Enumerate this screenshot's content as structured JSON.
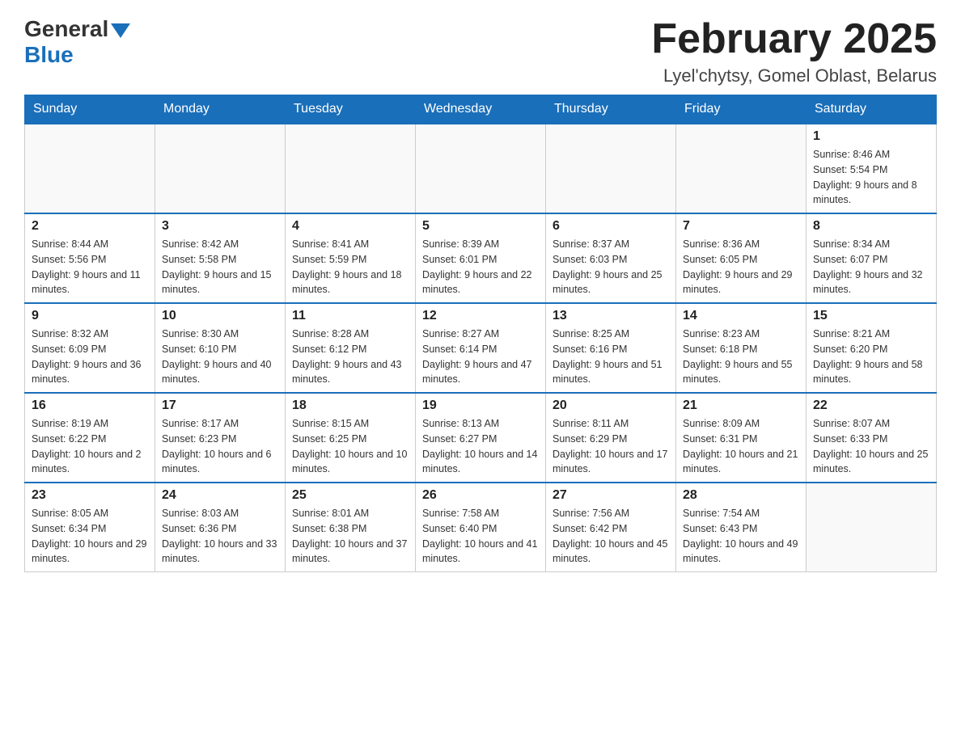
{
  "header": {
    "logo_general": "General",
    "logo_blue": "Blue",
    "month_title": "February 2025",
    "location": "Lyel'chytsy, Gomel Oblast, Belarus"
  },
  "weekdays": [
    "Sunday",
    "Monday",
    "Tuesday",
    "Wednesday",
    "Thursday",
    "Friday",
    "Saturday"
  ],
  "weeks": [
    [
      {
        "day": "",
        "sunrise": "",
        "sunset": "",
        "daylight": ""
      },
      {
        "day": "",
        "sunrise": "",
        "sunset": "",
        "daylight": ""
      },
      {
        "day": "",
        "sunrise": "",
        "sunset": "",
        "daylight": ""
      },
      {
        "day": "",
        "sunrise": "",
        "sunset": "",
        "daylight": ""
      },
      {
        "day": "",
        "sunrise": "",
        "sunset": "",
        "daylight": ""
      },
      {
        "day": "",
        "sunrise": "",
        "sunset": "",
        "daylight": ""
      },
      {
        "day": "1",
        "sunrise": "Sunrise: 8:46 AM",
        "sunset": "Sunset: 5:54 PM",
        "daylight": "Daylight: 9 hours and 8 minutes."
      }
    ],
    [
      {
        "day": "2",
        "sunrise": "Sunrise: 8:44 AM",
        "sunset": "Sunset: 5:56 PM",
        "daylight": "Daylight: 9 hours and 11 minutes."
      },
      {
        "day": "3",
        "sunrise": "Sunrise: 8:42 AM",
        "sunset": "Sunset: 5:58 PM",
        "daylight": "Daylight: 9 hours and 15 minutes."
      },
      {
        "day": "4",
        "sunrise": "Sunrise: 8:41 AM",
        "sunset": "Sunset: 5:59 PM",
        "daylight": "Daylight: 9 hours and 18 minutes."
      },
      {
        "day": "5",
        "sunrise": "Sunrise: 8:39 AM",
        "sunset": "Sunset: 6:01 PM",
        "daylight": "Daylight: 9 hours and 22 minutes."
      },
      {
        "day": "6",
        "sunrise": "Sunrise: 8:37 AM",
        "sunset": "Sunset: 6:03 PM",
        "daylight": "Daylight: 9 hours and 25 minutes."
      },
      {
        "day": "7",
        "sunrise": "Sunrise: 8:36 AM",
        "sunset": "Sunset: 6:05 PM",
        "daylight": "Daylight: 9 hours and 29 minutes."
      },
      {
        "day": "8",
        "sunrise": "Sunrise: 8:34 AM",
        "sunset": "Sunset: 6:07 PM",
        "daylight": "Daylight: 9 hours and 32 minutes."
      }
    ],
    [
      {
        "day": "9",
        "sunrise": "Sunrise: 8:32 AM",
        "sunset": "Sunset: 6:09 PM",
        "daylight": "Daylight: 9 hours and 36 minutes."
      },
      {
        "day": "10",
        "sunrise": "Sunrise: 8:30 AM",
        "sunset": "Sunset: 6:10 PM",
        "daylight": "Daylight: 9 hours and 40 minutes."
      },
      {
        "day": "11",
        "sunrise": "Sunrise: 8:28 AM",
        "sunset": "Sunset: 6:12 PM",
        "daylight": "Daylight: 9 hours and 43 minutes."
      },
      {
        "day": "12",
        "sunrise": "Sunrise: 8:27 AM",
        "sunset": "Sunset: 6:14 PM",
        "daylight": "Daylight: 9 hours and 47 minutes."
      },
      {
        "day": "13",
        "sunrise": "Sunrise: 8:25 AM",
        "sunset": "Sunset: 6:16 PM",
        "daylight": "Daylight: 9 hours and 51 minutes."
      },
      {
        "day": "14",
        "sunrise": "Sunrise: 8:23 AM",
        "sunset": "Sunset: 6:18 PM",
        "daylight": "Daylight: 9 hours and 55 minutes."
      },
      {
        "day": "15",
        "sunrise": "Sunrise: 8:21 AM",
        "sunset": "Sunset: 6:20 PM",
        "daylight": "Daylight: 9 hours and 58 minutes."
      }
    ],
    [
      {
        "day": "16",
        "sunrise": "Sunrise: 8:19 AM",
        "sunset": "Sunset: 6:22 PM",
        "daylight": "Daylight: 10 hours and 2 minutes."
      },
      {
        "day": "17",
        "sunrise": "Sunrise: 8:17 AM",
        "sunset": "Sunset: 6:23 PM",
        "daylight": "Daylight: 10 hours and 6 minutes."
      },
      {
        "day": "18",
        "sunrise": "Sunrise: 8:15 AM",
        "sunset": "Sunset: 6:25 PM",
        "daylight": "Daylight: 10 hours and 10 minutes."
      },
      {
        "day": "19",
        "sunrise": "Sunrise: 8:13 AM",
        "sunset": "Sunset: 6:27 PM",
        "daylight": "Daylight: 10 hours and 14 minutes."
      },
      {
        "day": "20",
        "sunrise": "Sunrise: 8:11 AM",
        "sunset": "Sunset: 6:29 PM",
        "daylight": "Daylight: 10 hours and 17 minutes."
      },
      {
        "day": "21",
        "sunrise": "Sunrise: 8:09 AM",
        "sunset": "Sunset: 6:31 PM",
        "daylight": "Daylight: 10 hours and 21 minutes."
      },
      {
        "day": "22",
        "sunrise": "Sunrise: 8:07 AM",
        "sunset": "Sunset: 6:33 PM",
        "daylight": "Daylight: 10 hours and 25 minutes."
      }
    ],
    [
      {
        "day": "23",
        "sunrise": "Sunrise: 8:05 AM",
        "sunset": "Sunset: 6:34 PM",
        "daylight": "Daylight: 10 hours and 29 minutes."
      },
      {
        "day": "24",
        "sunrise": "Sunrise: 8:03 AM",
        "sunset": "Sunset: 6:36 PM",
        "daylight": "Daylight: 10 hours and 33 minutes."
      },
      {
        "day": "25",
        "sunrise": "Sunrise: 8:01 AM",
        "sunset": "Sunset: 6:38 PM",
        "daylight": "Daylight: 10 hours and 37 minutes."
      },
      {
        "day": "26",
        "sunrise": "Sunrise: 7:58 AM",
        "sunset": "Sunset: 6:40 PM",
        "daylight": "Daylight: 10 hours and 41 minutes."
      },
      {
        "day": "27",
        "sunrise": "Sunrise: 7:56 AM",
        "sunset": "Sunset: 6:42 PM",
        "daylight": "Daylight: 10 hours and 45 minutes."
      },
      {
        "day": "28",
        "sunrise": "Sunrise: 7:54 AM",
        "sunset": "Sunset: 6:43 PM",
        "daylight": "Daylight: 10 hours and 49 minutes."
      },
      {
        "day": "",
        "sunrise": "",
        "sunset": "",
        "daylight": ""
      }
    ]
  ]
}
